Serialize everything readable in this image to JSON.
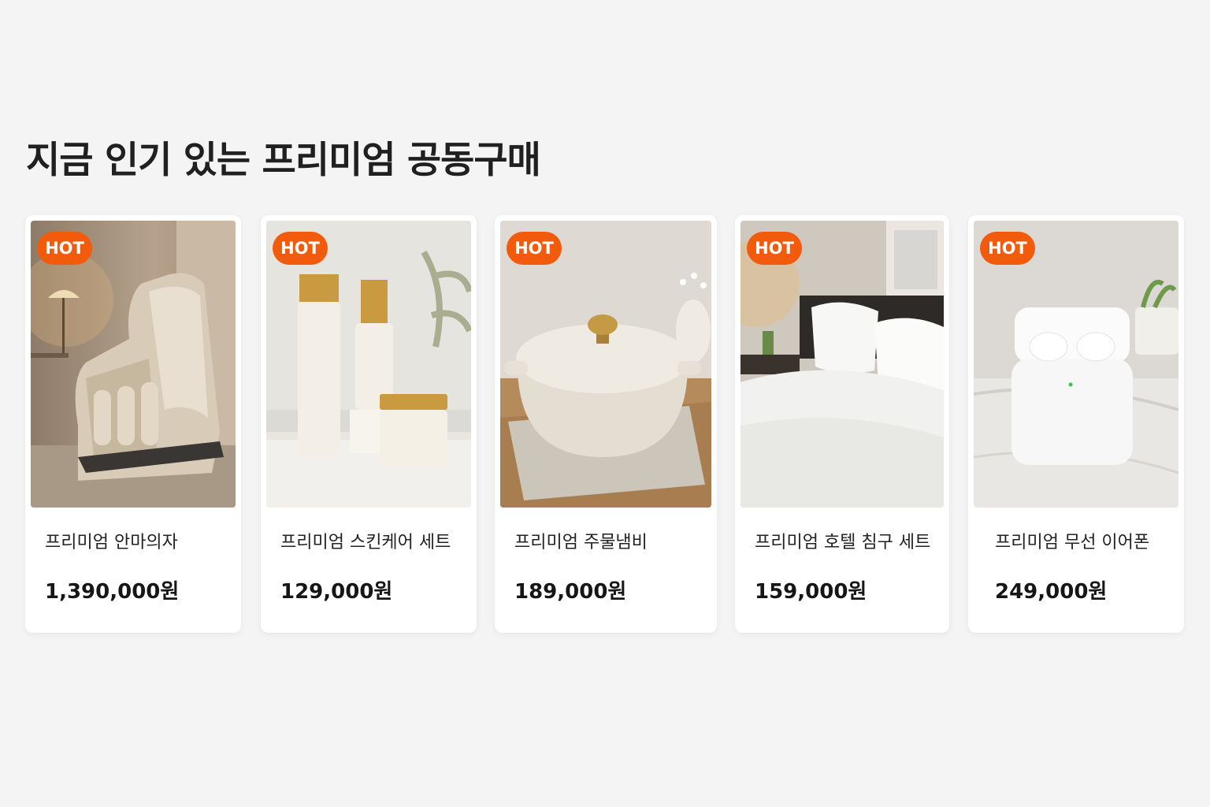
{
  "section": {
    "title": "지금 인기 있는 프리미엄 공동구매"
  },
  "colors": {
    "background": "#f4f4f4",
    "card": "#ffffff",
    "badge": "#f25a0c",
    "text": "#222222"
  },
  "products": [
    {
      "badge": "HOT",
      "name": "프리미엄 안마의자",
      "price": "1,390,000원",
      "image": "massage-chair-image"
    },
    {
      "badge": "HOT",
      "name": "프리미엄 스킨케어 세트",
      "price": "129,000원",
      "image": "skincare-set-image"
    },
    {
      "badge": "HOT",
      "name": "프리미엄 주물냄비",
      "price": "189,000원",
      "image": "cast-iron-pot-image"
    },
    {
      "badge": "HOT",
      "name": "프리미엄 호텔 침구 세트",
      "price": "159,000원",
      "image": "hotel-bedding-image"
    },
    {
      "badge": "HOT",
      "name": "프리미엄 무선 이어폰",
      "price": "249,000원",
      "image": "wireless-earbuds-image"
    }
  ]
}
